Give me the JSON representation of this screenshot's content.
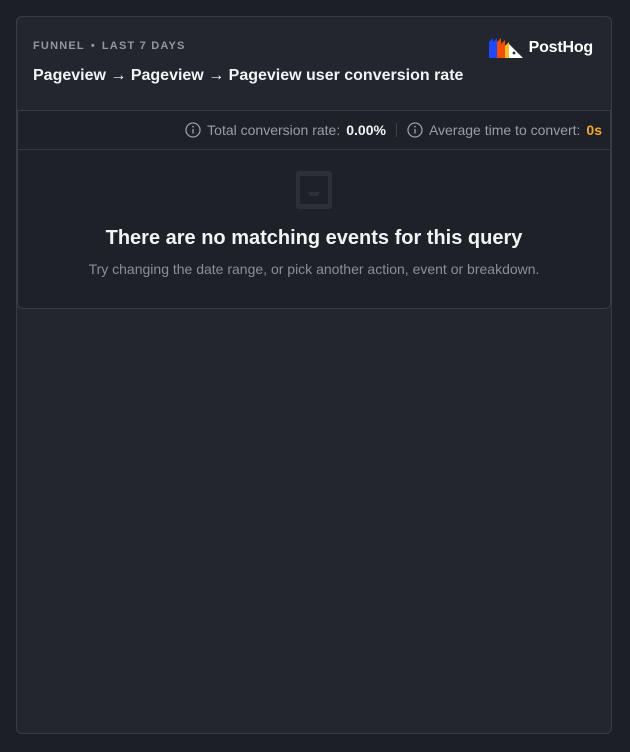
{
  "card": {
    "eyebrow": {
      "type": "FUNNEL",
      "separator": "•",
      "range": "LAST 7 DAYS"
    },
    "title": "Pageview → Pageview → Pageview user conversion rate",
    "logo": {
      "text": "PostHog",
      "icon": "posthog-logo-icon",
      "colors": [
        "#1d4aff",
        "#f54e00",
        "#f9bd2b",
        "#ffffff"
      ]
    }
  },
  "stats": {
    "total_label": "Total conversion rate:",
    "total_value": "0.00%",
    "avg_label": "Average time to convert:",
    "avg_value": "0s",
    "accent_color": "#f1a82c"
  },
  "empty_state": {
    "icon": "inbox-icon",
    "title": "There are no matching events for this query",
    "subtitle": "Try changing the date range, or pick another action, event or breakdown."
  }
}
